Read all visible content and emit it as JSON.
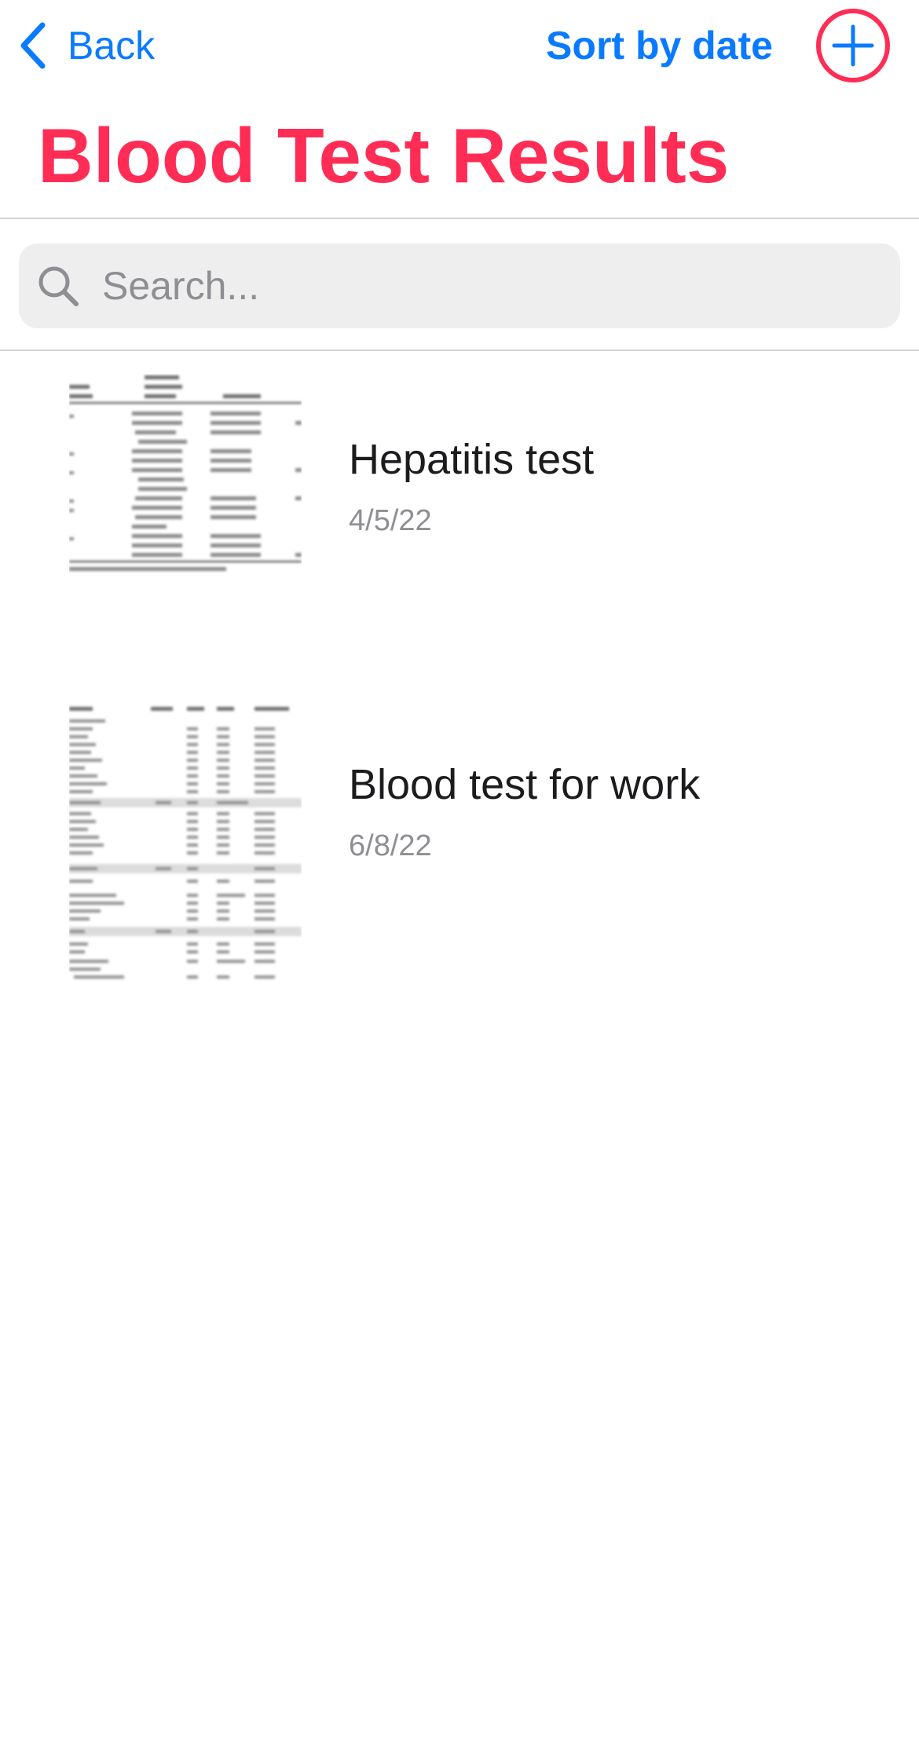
{
  "nav": {
    "back_label": "Back",
    "sort_label": "Sort by date"
  },
  "page_title": "Blood Test Results",
  "search": {
    "placeholder": "Search...",
    "value": ""
  },
  "results": [
    {
      "title": "Hepatitis test",
      "date": "4/5/22",
      "thumbnail_icon": "blurred-document-thumbnail"
    },
    {
      "title": "Blood test for work",
      "date": "6/8/22",
      "thumbnail_icon": "blurred-document-thumbnail"
    }
  ],
  "colors": {
    "accent_blue": "#0a7aff",
    "accent_pink": "#ff2d55",
    "secondary_text": "#8e8e93",
    "search_background": "#eeeeef",
    "divider": "#d1d1d6"
  },
  "icons": {
    "back": "chevron-left-icon",
    "add": "plus-circle-icon",
    "search": "magnifying-glass-icon"
  }
}
